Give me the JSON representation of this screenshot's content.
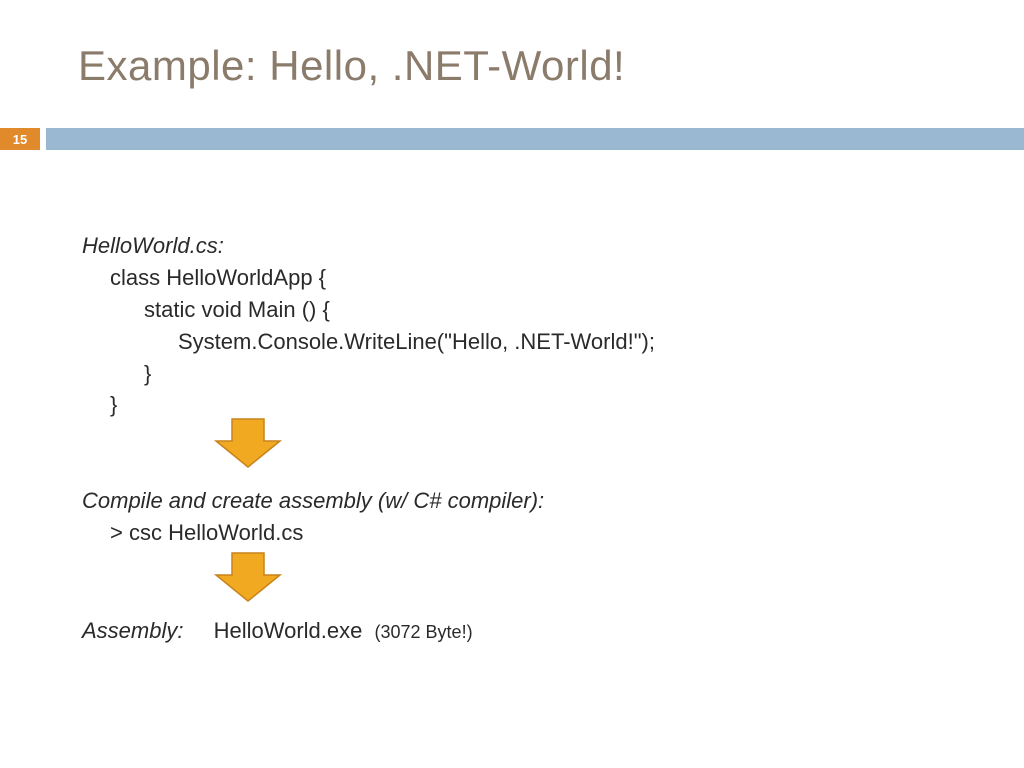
{
  "slide": {
    "title": "Example: Hello, .NET-World!",
    "page_number": "15"
  },
  "section1": {
    "heading": "HelloWorld.cs:",
    "code": {
      "l1": "class HelloWorldApp {",
      "l2": "static void Main () {",
      "l3": "System.Console.WriteLine(\"Hello, .NET-World!\");",
      "l4": "}",
      "l5": "}"
    }
  },
  "section2": {
    "heading": "Compile and create assembly (w/ C# compiler):",
    "command": "> csc HelloWorld.cs"
  },
  "section3": {
    "label": "Assembly:",
    "file": "HelloWorld.exe",
    "size": "(3072 Byte!)"
  },
  "colors": {
    "title": "#8b7b6b",
    "badge": "#e08a2c",
    "bar": "#9bb8d3",
    "arrow_fill": "#f2a922",
    "arrow_stroke": "#c7841a"
  }
}
